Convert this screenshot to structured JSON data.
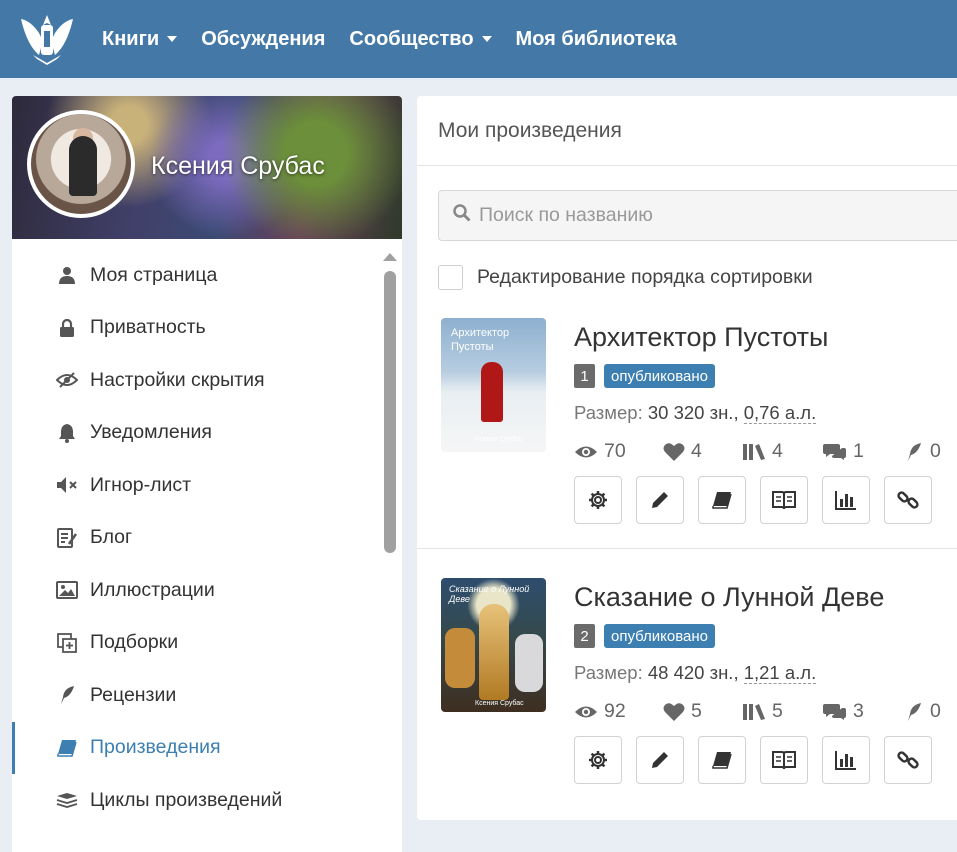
{
  "header": {
    "brand_color": "#4479a7",
    "nav": [
      {
        "label": "Книги",
        "dropdown": true
      },
      {
        "label": "Обсуждения",
        "dropdown": false
      },
      {
        "label": "Сообщество",
        "dropdown": true
      },
      {
        "label": "Моя библиотека",
        "dropdown": false
      }
    ]
  },
  "profile": {
    "name": "Ксения Срубас"
  },
  "sidebar": {
    "items": [
      {
        "label": "Моя страница",
        "icon": "user-icon"
      },
      {
        "label": "Приватность",
        "icon": "lock-icon"
      },
      {
        "label": "Настройки скрытия",
        "icon": "eye-slash-icon"
      },
      {
        "label": "Уведомления",
        "icon": "bell-icon"
      },
      {
        "label": "Игнор-лист",
        "icon": "mute-icon"
      },
      {
        "label": "Блог",
        "icon": "blog-icon"
      },
      {
        "label": "Иллюстрации",
        "icon": "image-icon"
      },
      {
        "label": "Подборки",
        "icon": "collection-icon"
      },
      {
        "label": "Рецензии",
        "icon": "quill-icon"
      },
      {
        "label": "Произведения",
        "icon": "book-icon",
        "active": true
      },
      {
        "label": "Циклы произведений",
        "icon": "stack-icon"
      }
    ],
    "active_color": "#3c7fb0"
  },
  "main": {
    "title": "Мои произведения",
    "search_placeholder": "Поиск по названию",
    "sort_label": "Редактирование порядка сортировки",
    "size_label": "Размер:",
    "works": [
      {
        "cover_title": "Архитектор Пустоты",
        "cover_author": "Ксения Срубас",
        "title": "Архитектор Пустоты",
        "order": "1",
        "status": "опубликовано",
        "size_chars": "30 320 зн.,",
        "size_al": "0,76 а.л.",
        "views": "70",
        "likes": "4",
        "libraries": "4",
        "comments": "1",
        "reviews": "0"
      },
      {
        "cover_title": "Сказание о Лунной Деве",
        "cover_author": "Ксения Срубас",
        "title": "Сказание о Лунной Деве",
        "order": "2",
        "status": "опубликовано",
        "size_chars": "48 420 зн.,",
        "size_al": "1,21 а.л.",
        "views": "92",
        "likes": "5",
        "libraries": "5",
        "comments": "3",
        "reviews": "0"
      }
    ]
  }
}
